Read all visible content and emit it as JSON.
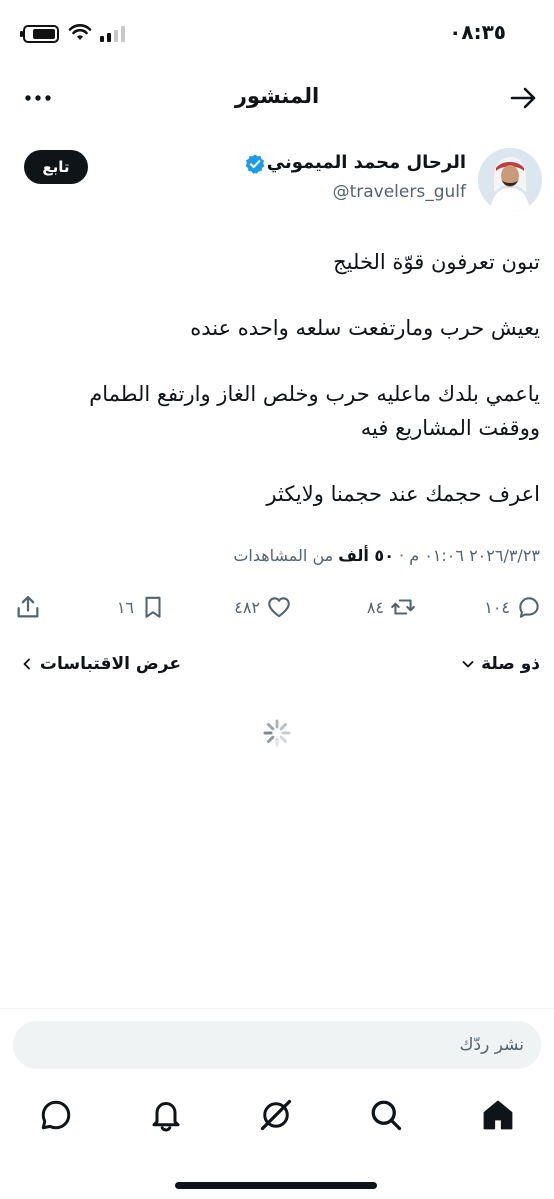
{
  "status_bar": {
    "time": "٠٨:٣٥"
  },
  "header": {
    "title": "المنشور"
  },
  "author": {
    "name": "الرحال محمد الميموني",
    "handle": "@travelers_gulf",
    "follow_label": "تابع"
  },
  "post": {
    "lines": [
      "تبون تعرفون قوّة الخليج",
      "يعيش حرب ومارتفعت سلعه واحده عنده",
      "ياعمي بلدك ماعليه حرب وخلص الغاز وارتفع الطمام",
      "ووقفت المشاريع فيه",
      "اعرف حجمك عند حجمنا ولايكثر"
    ]
  },
  "meta": {
    "datetime": "٢٠٢٦/٣/٢٣ ٠١:٠٦ م · ",
    "views_count": "٥٠ ألف",
    "views_label": " من المشاهدات"
  },
  "engagement": {
    "replies": "١٠٤",
    "reposts": "٨٤",
    "likes": "٤٨٢",
    "bookmarks": "١٦"
  },
  "related_label": "ذو صلة",
  "quotes_label": "عرض الاقتباسات",
  "reply_placeholder": "نشر ردّك",
  "icons": {
    "back": "arrow-right-icon",
    "more": "more-dots-icon",
    "verified": "verified-badge-icon",
    "reply": "comment-icon",
    "repost": "repost-icon",
    "like": "heart-icon",
    "bookmark": "bookmark-icon",
    "share": "share-icon",
    "loading": "loading-spinner-icon",
    "nav_home": "home-icon",
    "nav_search": "search-icon",
    "nav_grok": "grok-icon",
    "nav_notifications": "bell-icon",
    "nav_messages": "messages-icon"
  },
  "colors": {
    "text": "#0f1419",
    "secondary": "#536471",
    "verified": "#1d9bf0",
    "follow_bg": "#0f1419",
    "reply_bar_bg": "#eff3f4"
  }
}
